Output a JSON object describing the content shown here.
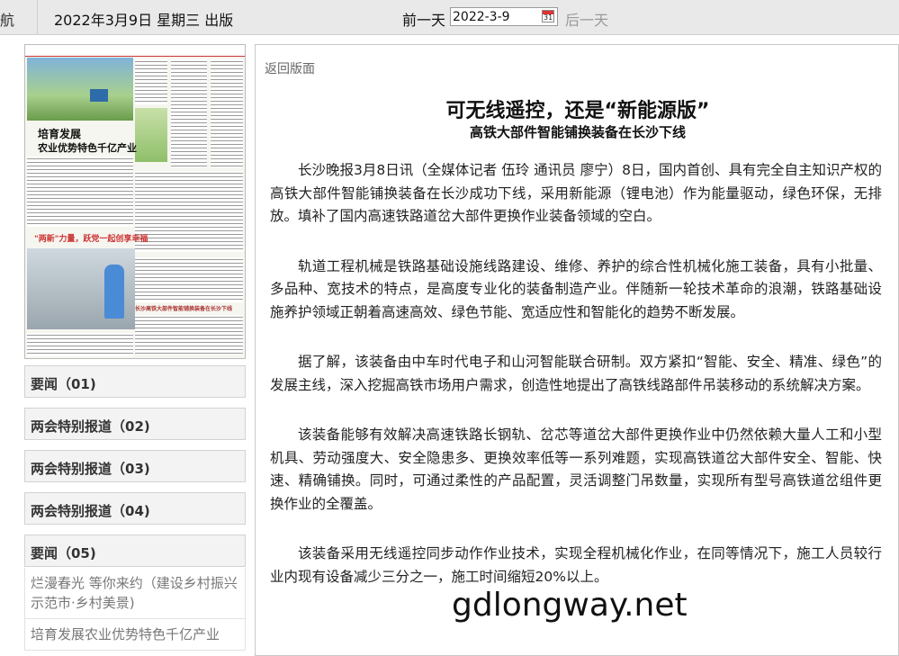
{
  "topbar": {
    "nav_tail": "航",
    "edition": "2022年3月9日 星期三 出版",
    "prev_label": "前一天",
    "date_value": "2022-3-9",
    "calendar_day": "31",
    "next_label": "后一天"
  },
  "thumbnail": {
    "headline_1": "培育发展",
    "headline_2": "农业优势特色千亿产业",
    "headline_3": "\"两新\"力量，跃党一起创享幸福",
    "footer_line": "长沙高铁大部件智能铺换装备在长沙下线"
  },
  "sections": [
    {
      "label": "要闻（01)"
    },
    {
      "label": "两会特别报道（02)"
    },
    {
      "label": "两会特别报道（03)"
    },
    {
      "label": "两会特别报道（04)"
    },
    {
      "label": "要闻（05)"
    }
  ],
  "articles": [
    {
      "label": "烂漫春光 等你来约（建设乡村振兴示范市·乡村美景)"
    },
    {
      "label": "培育发展农业优势特色千亿产业"
    }
  ],
  "article": {
    "back_label": "返回版面",
    "title": "可无线遥控，还是“新能源版”",
    "subtitle": "高铁大部件智能铺换装备在长沙下线",
    "paragraphs": [
      "长沙晚报3月8日讯（全媒体记者 伍玲 通讯员 廖宁）8日，国内首创、具有完全自主知识产权的高铁大部件智能铺换装备在长沙成功下线，采用新能源（锂电池）作为能量驱动，绿色环保，无排放。填补了国内高速铁路道岔大部件更换作业装备领域的空白。",
      "轨道工程机械是铁路基础设施线路建设、维修、养护的综合性机械化施工装备，具有小批量、多品种、宽技术的特点，是高度专业化的装备制造产业。伴随新一轮技术革命的浪潮，铁路基础设施养护领域正朝着高速高效、绿色节能、宽适应性和智能化的趋势不断发展。",
      "据了解，该装备由中车时代电子和山河智能联合研制。双方紧扣“智能、安全、精准、绿色”的发展主线，深入挖掘高铁市场用户需求，创造性地提出了高铁线路部件吊装移动的系统解决方案。",
      "该装备能够有效解决高速铁路长钢轨、岔芯等道岔大部件更换作业中仍然依赖大量人工和小型机具、劳动强度大、安全隐患多、更换效率低等一系列难题，实现高铁道岔大部件安全、智能、快速、精确铺换。同时，可通过柔性的产品配置，灵活调整门吊数量，实现所有型号高铁道岔组件更换作业的全覆盖。",
      "该装备采用无线遥控同步动作作业技术，实现全程机械化作业，在同等情况下，施工人员较行业内现有设备减少三分之一，施工时间缩短20%以上。"
    ]
  },
  "watermark": "gdlongway.net"
}
